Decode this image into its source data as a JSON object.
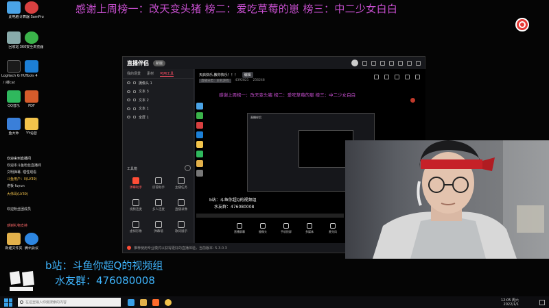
{
  "banner": {
    "text": "感谢上周榜一：改天变头猪 榜二：爱吃草莓的崽 榜三：中二少女白白"
  },
  "desktop": {
    "icons": [
      {
        "label": "此电脑",
        "color": "#4aa3e6"
      },
      {
        "label": "计算器 SamPro机器",
        "color": "#d84040"
      },
      {
        "label": "回收站",
        "color": "#8aa"
      },
      {
        "label": "360安全浏览器",
        "color": "#3bb34a"
      },
      {
        "label": "Logitech G HUB",
        "color": "#1a1a1a"
      },
      {
        "label": "Tools 4",
        "color": "#1c7fd6"
      },
      {
        "label": "QQ音乐",
        "color": "#2fb85d"
      },
      {
        "label": "PDF",
        "color": "#d65c2b"
      },
      {
        "label": "鱼大师",
        "color": "#3a7fd9"
      },
      {
        "label": "YY语音",
        "color": "#f2c34b"
      },
      {
        "label": "新建文件夹",
        "color": "#e2b04a"
      },
      {
        "label": "腾讯会议",
        "color": "#2d86e0"
      }
    ],
    "side_lines": [
      "八楼cat",
      "欢迎来到直播间",
      "欢迎本斗鱼粉丝直播间",
      "文明弹幕, 理性观看",
      "斗鱼用户：ll(LV39)",
      "老板 fuyun",
      "大伟哥(LV39)",
      "欢迎粉丝团成员",
      "感谢礼物支持"
    ]
  },
  "app": {
    "logo": "直播伴侣",
    "badge": "新版",
    "panel_tabs": [
      "我的场景",
      "素材",
      "可用工具"
    ],
    "scenes": [
      "摄像头 1",
      "文本 3",
      "文本 2",
      "文本 1",
      "全屏 1"
    ],
    "tools_title": "工具箱",
    "tools": [
      "弹幕助手",
      "房管助手",
      "主播任务",
      "视频连麦",
      "多人连麦",
      "直播录像",
      "虚拟形象",
      "弹幕墙",
      "歌词展示",
      "PK",
      "更多",
      "互动"
    ],
    "status_text": "推荐使用专业模式以获得更好的直播体验，当前版本: 5.3.0.3",
    "preview_title": "天启快乐,教你快乐！！！",
    "preview_btn": "编辑",
    "preview_meta": [
      "直播分类：主机游戏",
      "4392821",
      "256248"
    ],
    "preview_overlay_text": "感谢上周榜一：改天变头猪 榜二：爱吃草莓的崽 榜三：中二少女白白",
    "nested_title": "直播伴侣",
    "preview_bili": "b站：斗鱼你超Q的视频组",
    "preview_qq": "水友群：476080008",
    "controls": [
      "直播屏幕",
      "摄像头",
      "手机投屏",
      "多媒体",
      "麦克风",
      "扬声器"
    ]
  },
  "overlay": {
    "bili": "b站：斗鱼你超Q的视频组",
    "qq": "水友群：476080008"
  },
  "taskbar": {
    "search_placeholder": "在这里输入你要搜索的内容",
    "time": "12:05 周六",
    "date": "2022/1/1"
  }
}
